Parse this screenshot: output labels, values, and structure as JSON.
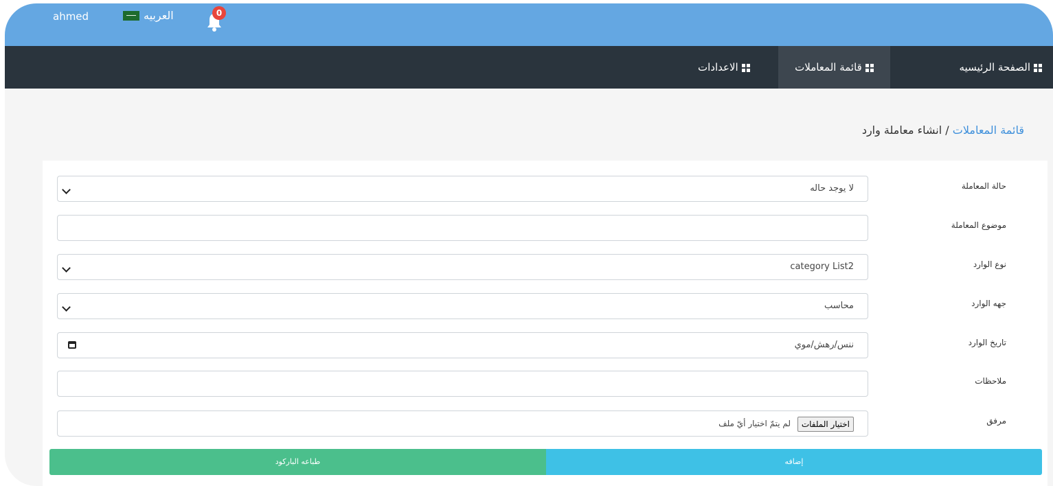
{
  "topbar": {
    "username": "ahmed",
    "language": "العربيه",
    "notifications_count": "0",
    "bell_icon": "bell-icon",
    "flag_icon": "saudi-flag-icon"
  },
  "nav": {
    "items": [
      {
        "label": "الصفحة الرئيسيه"
      },
      {
        "label": "قائمة المعاملات"
      },
      {
        "label": "الاعدادات"
      }
    ],
    "active": 1
  },
  "breadcrumb": {
    "parent": "قائمة المعاملات",
    "separator": "/",
    "current": "انشاء معاملة وارد"
  },
  "form": {
    "status_label": "حالة المعاملة",
    "status_value": "لا يوجد حاله",
    "subject_label": "موضوع المعاملة",
    "subject_value": "",
    "type_label": "نوع الوارد",
    "type_value": "category List2",
    "source_label": "جهه الوارد",
    "source_value": "محاسب",
    "date_label": "تاريخ الوارد",
    "date_placeholder": "ننس/رهش/موي",
    "notes_label": "ملاحظات",
    "notes_value": "",
    "attachment_label": "مرفق",
    "file_button": "اختيار الملفات",
    "file_status": "لم يتمّ اختيار أيّ ملف"
  },
  "buttons": {
    "add": "إضافه",
    "print_barcode": "طباعه الباركود"
  },
  "colors": {
    "topbar": "#64a7e2",
    "navbar": "#2a343d",
    "nav_active": "#3d464f",
    "add_button": "#3ec1e6",
    "print_button": "#4bbf8c",
    "link": "#3d8fdb",
    "badge": "#e8453c"
  }
}
